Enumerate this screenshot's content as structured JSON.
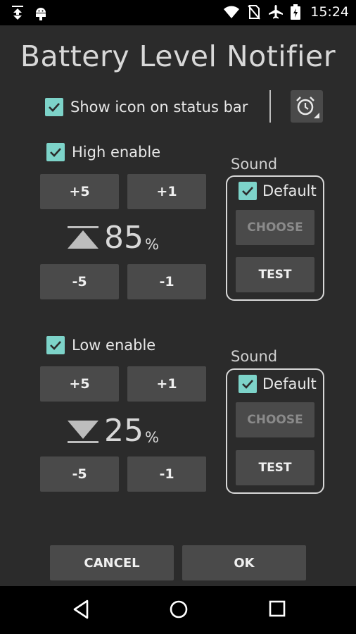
{
  "status_bar": {
    "time": "15:24",
    "left_icons": [
      "download-icon",
      "android-icon"
    ],
    "right_icons": [
      "wifi-icon",
      "no-sim-icon",
      "airplane-icon",
      "battery-icon"
    ]
  },
  "app": {
    "title": "Battery Level Notifier"
  },
  "show_icon": {
    "label": "Show icon on status bar",
    "checked": true
  },
  "high": {
    "enable_label": "High enable",
    "checked": true,
    "plus5": "+5",
    "plus1": "+1",
    "minus5": "-5",
    "minus1": "-1",
    "value": "85",
    "unit": "%",
    "sound": {
      "label": "Sound",
      "default_label": "Default",
      "default_checked": true,
      "choose": "CHOOSE",
      "test": "TEST"
    }
  },
  "low": {
    "enable_label": "Low enable",
    "checked": true,
    "plus5": "+5",
    "plus1": "+1",
    "minus5": "-5",
    "minus1": "-1",
    "value": "25",
    "unit": "%",
    "sound": {
      "label": "Sound",
      "default_label": "Default",
      "default_checked": true,
      "choose": "CHOOSE",
      "test": "TEST"
    }
  },
  "footer": {
    "cancel": "CANCEL",
    "ok": "OK"
  },
  "colors": {
    "accent": "#7dd3c9",
    "background": "#2b2b2b",
    "button": "#4a4a4a"
  }
}
